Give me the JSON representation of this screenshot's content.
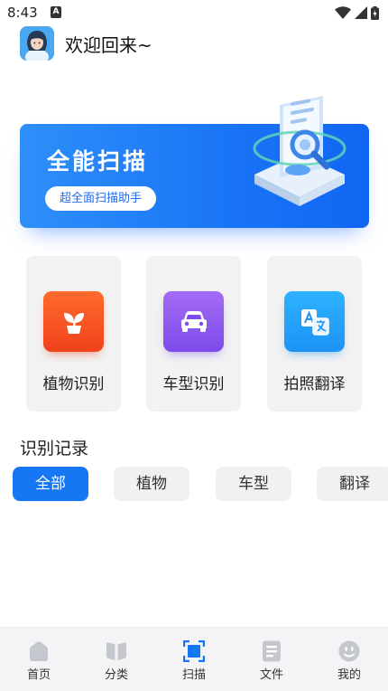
{
  "status_bar": {
    "time": "8:43",
    "notification_badge": "A"
  },
  "header": {
    "greeting": "欢迎回来~"
  },
  "banner": {
    "title": "全能扫描",
    "button_label": "超全面扫描助手"
  },
  "features": [
    {
      "label": "植物识别",
      "icon": "plant-icon",
      "color": "#f0421c"
    },
    {
      "label": "车型识别",
      "icon": "car-icon",
      "color": "#7c4bea"
    },
    {
      "label": "拍照翻译",
      "icon": "translate-icon",
      "color": "#1d93f5"
    }
  ],
  "records": {
    "title": "识别记录",
    "filters": [
      "全部",
      "植物",
      "车型",
      "翻译"
    ],
    "active_filter": "全部"
  },
  "bottom_nav": {
    "items": [
      {
        "label": "首页",
        "icon": "home-icon"
      },
      {
        "label": "分类",
        "icon": "category-icon"
      },
      {
        "label": "扫描",
        "icon": "scan-icon"
      },
      {
        "label": "文件",
        "icon": "file-icon"
      },
      {
        "label": "我的",
        "icon": "profile-icon"
      }
    ],
    "active_color": "#1677f5",
    "inactive_color": "#c4c7ce"
  }
}
